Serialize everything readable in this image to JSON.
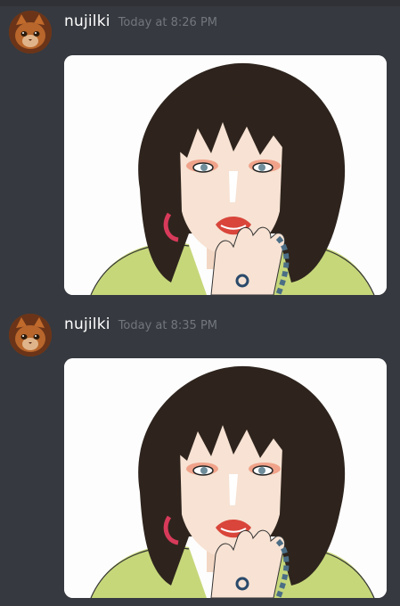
{
  "messages": [
    {
      "author": "nujilki",
      "timestamp": "Today at 8:26 PM",
      "attachment": {
        "type": "image",
        "description_icon": "portrait-illustration"
      }
    },
    {
      "author": "nujilki",
      "timestamp": "Today at 8:35 PM",
      "attachment": {
        "type": "image",
        "description_icon": "portrait-illustration"
      }
    }
  ],
  "colors": {
    "background": "#36393f",
    "username": "#ffffff",
    "timestamp": "#72767d"
  }
}
